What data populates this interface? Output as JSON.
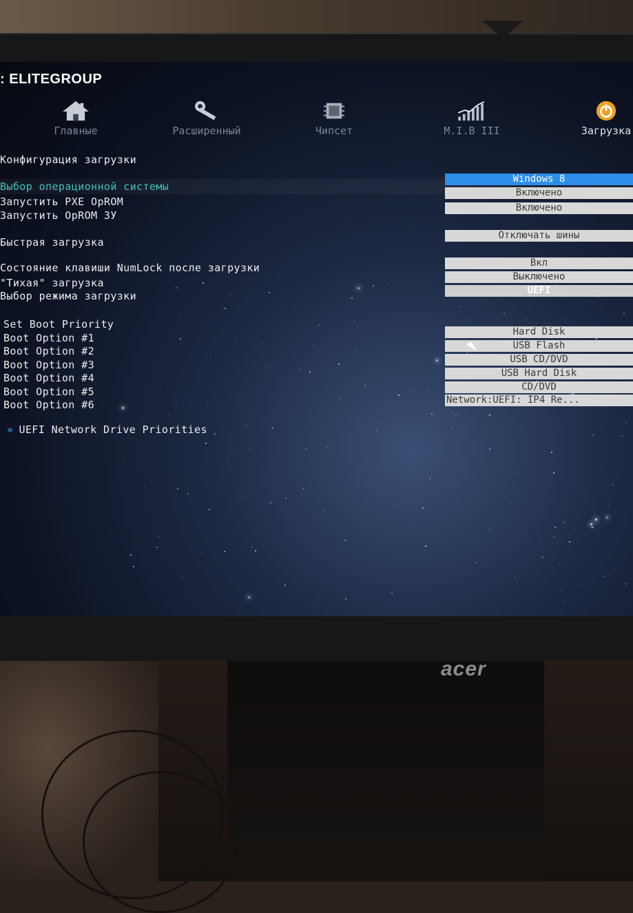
{
  "brand": {
    "bios_vendor": "ELITEGROUP",
    "monitor": "acer"
  },
  "tabs": [
    {
      "label": "Главные",
      "icon": "home-icon"
    },
    {
      "label": "Расширенный",
      "icon": "wrench-icon"
    },
    {
      "label": "Чипсет",
      "icon": "chip-icon"
    },
    {
      "label": "M.I.B III",
      "icon": "chart-icon"
    },
    {
      "label": "Загрузка",
      "icon": "power-icon"
    }
  ],
  "section_title": "Конфигурация загрузки",
  "settings": [
    {
      "label": "Выбор операционной системы",
      "value": "Windows 8"
    },
    {
      "label": "Запустить PXE OpROM",
      "value": "Включено"
    },
    {
      "label": "Запустить OpROM ЗУ",
      "value": "Включено"
    },
    {
      "label": "Быстрая загрузка",
      "value": "Отключать шины"
    },
    {
      "label": "Состояние клавиши NumLock после загрузки",
      "value": "Вкл"
    },
    {
      "label": "\"Тихая\" загрузка",
      "value": "Выключено"
    },
    {
      "label": "Выбор режима загрузки",
      "value": "UEFI"
    }
  ],
  "boot_priority": {
    "title": "Set Boot Priority",
    "options": [
      {
        "label": "Boot Option #1",
        "value": "Hard Disk"
      },
      {
        "label": "Boot Option #2",
        "value": "USB Flash"
      },
      {
        "label": "Boot Option #3",
        "value": "USB CD/DVD"
      },
      {
        "label": "Boot Option #4",
        "value": "USB Hard Disk"
      },
      {
        "label": "Boot Option #5",
        "value": "CD/DVD"
      },
      {
        "label": "Boot Option #6",
        "value": "Network:UEFI: IP4 Re..."
      }
    ]
  },
  "submenu": {
    "label": "UEFI Network Drive Priorities"
  },
  "colors": {
    "accent": "#2c8ee8",
    "highlight_text": "#3fc2c0",
    "active_tab": "#f0a020"
  }
}
